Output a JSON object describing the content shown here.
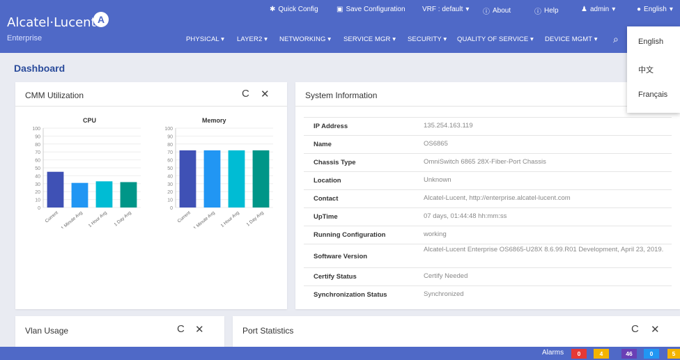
{
  "brand": {
    "name": "Alcatel·Lucent",
    "sub": "Enterprise",
    "mark": "A"
  },
  "utility": {
    "quick_config": "Quick Config",
    "save_config": "Save Configuration",
    "vrf": "VRF : default",
    "about": "About",
    "help": "Help",
    "user": "admin",
    "language": "English"
  },
  "nav": [
    {
      "label": "PHYSICAL"
    },
    {
      "label": "LAYER2"
    },
    {
      "label": "NETWORKING"
    },
    {
      "label": "SERVICE MGR"
    },
    {
      "label": "SECURITY"
    },
    {
      "label": "QUALITY OF SERVICE"
    },
    {
      "label": "DEVICE MGMT"
    }
  ],
  "language_menu": [
    "English",
    "中文",
    "Français"
  ],
  "page_title": "Dashboard",
  "cmm_card": {
    "title": "CMM Utilization",
    "refresh_icon": "C",
    "close_icon": "✕"
  },
  "chart_data": [
    {
      "type": "bar",
      "title": "CPU",
      "categories": [
        "Current",
        "1 Minute Avg",
        "1 Hour Avg",
        "1 Day Avg"
      ],
      "values": [
        45,
        31,
        33,
        32
      ],
      "ylim": [
        0,
        100
      ],
      "yticks": [
        100,
        90,
        80,
        70,
        60,
        50,
        40,
        30,
        20,
        10,
        0
      ],
      "colors": [
        "#3f51b5",
        "#2196f3",
        "#00bcd4",
        "#009688"
      ],
      "grid": true
    },
    {
      "type": "bar",
      "title": "Memory",
      "categories": [
        "Current",
        "1 Minute Avg",
        "1 Hour Avg",
        "1 Day Avg"
      ],
      "values": [
        72,
        72,
        72,
        72
      ],
      "ylim": [
        0,
        100
      ],
      "yticks": [
        100,
        90,
        80,
        70,
        60,
        50,
        40,
        30,
        20,
        10,
        0
      ],
      "colors": [
        "#3f51b5",
        "#2196f3",
        "#00bcd4",
        "#009688"
      ],
      "grid": true
    }
  ],
  "system_info": {
    "title": "System Information",
    "rows": [
      {
        "key": "IP Address",
        "value": "135.254.163.119"
      },
      {
        "key": "Name",
        "value": "OS6865"
      },
      {
        "key": "Chassis Type",
        "value": "OmniSwitch 6865 28X-Fiber-Port Chassis"
      },
      {
        "key": "Location",
        "value": "Unknown"
      },
      {
        "key": "Contact",
        "value": "Alcatel-Lucent, http://enterprise.alcatel-lucent.com"
      },
      {
        "key": "UpTime",
        "value": "07 days, 01:44:48 hh:mm:ss"
      },
      {
        "key": "Running Configuration",
        "value": "working"
      },
      {
        "key": "Software Version",
        "value": "Alcatel-Lucent Enterprise OS6865-U28X 8.6.99.R01 Development, April 23, 2019."
      },
      {
        "key": "Certify Status",
        "value": "Certify Needed"
      },
      {
        "key": "Synchronization Status",
        "value": "Synchronized"
      }
    ]
  },
  "vlan_card": {
    "title": "Vlan Usage",
    "refresh_icon": "C",
    "close_icon": "✕"
  },
  "port_card": {
    "title": "Port Statistics",
    "refresh_icon": "C",
    "close_icon": "✕"
  },
  "alarms": {
    "label": "Alarms",
    "badges": [
      {
        "value": "0",
        "color": "#e53935"
      },
      {
        "value": "4",
        "color": "#f4b400"
      },
      {
        "value": "46",
        "color": "#6a3fb5"
      },
      {
        "value": "0",
        "color": "#2196f3"
      },
      {
        "value": "5",
        "color": "#f4b400"
      }
    ]
  }
}
